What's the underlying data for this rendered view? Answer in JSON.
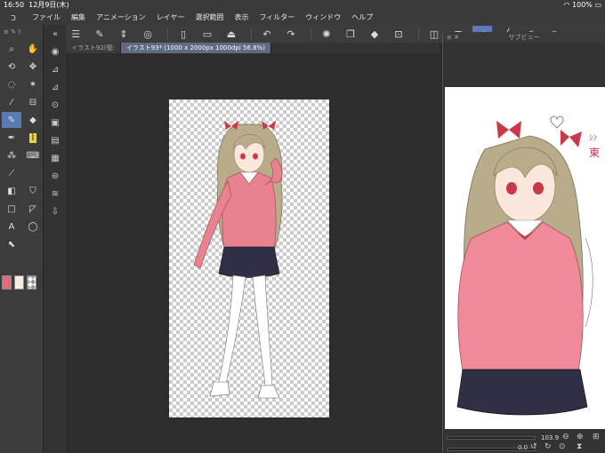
{
  "status": {
    "time": "16:50",
    "date": "12月9日(木)",
    "battery": "100%"
  },
  "menu": [
    "ファイル",
    "編集",
    "アニメーション",
    "レイヤー",
    "選択範囲",
    "表示",
    "フィルター",
    "ウィンドウ",
    "ヘルプ"
  ],
  "tabs": [
    "イラスト92(復:",
    "イラスト93* (1000 x 2000px 1000dpi 56.8%)"
  ],
  "subview": {
    "title": "サブビュー",
    "zoom": "103.9",
    "rotation": "0.0"
  },
  "colors": {
    "main": "#e66a7d",
    "sub": "#f8ece2",
    "accent": "#5a7bb5"
  }
}
